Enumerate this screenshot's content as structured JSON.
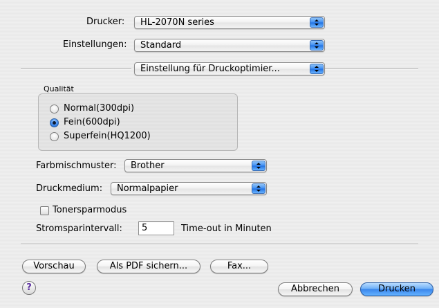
{
  "printer": {
    "label": "Drucker:",
    "value": "HL-2070N series"
  },
  "presets": {
    "label": "Einstellungen:",
    "value": "Standard"
  },
  "panel": {
    "value": "Einstellung für Druckoptimier..."
  },
  "quality": {
    "title": "Qualität",
    "options": [
      {
        "label": "Normal(300dpi)",
        "selected": false
      },
      {
        "label": "Fein(600dpi)",
        "selected": true
      },
      {
        "label": "Superfein(HQ1200)",
        "selected": false
      }
    ]
  },
  "color_pattern": {
    "label": "Farbmischmuster:",
    "value": "Brother"
  },
  "media": {
    "label": "Druckmedium:",
    "value": "Normalpapier"
  },
  "toner_save": {
    "label": "Tonersparmodus",
    "checked": false
  },
  "sleep": {
    "label": "Stromsparintervall:",
    "value": "5",
    "unit": "Time-out in Minuten"
  },
  "buttons": {
    "preview": "Vorschau",
    "save_pdf": "Als PDF sichern...",
    "fax": "Fax...",
    "help": "?",
    "cancel": "Abbrechen",
    "print": "Drucken"
  },
  "colors": {
    "accent": "#3a86ec",
    "background": "#ececec"
  }
}
